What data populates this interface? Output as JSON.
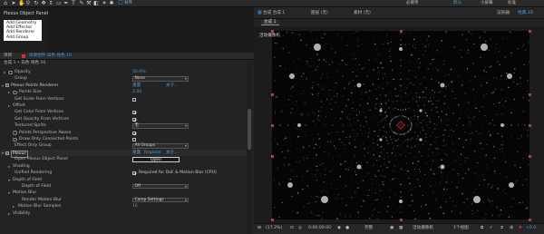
{
  "toolbar": {
    "snap_label": "对齐",
    "workspace_essentials": "必要项",
    "workspace_default": "默认",
    "workspace_small": "小屏幕",
    "workspace_standard": "标准",
    "icons": [
      "home-icon",
      "selection-icon",
      "hand-icon",
      "zoom-icon",
      "orbit-icon",
      "pan-icon",
      "dolly-icon",
      "rect-icon",
      "pen-icon",
      "text-icon",
      "brush-icon",
      "stamp-icon",
      "eraser-icon",
      "roto-icon",
      "puppet-icon",
      "snap-icon"
    ]
  },
  "plexus_panel": {
    "title": "Plexus Object Panel",
    "menu": [
      "Add Geometry",
      "Add Effector",
      "Add Renderer",
      "Add Group"
    ]
  },
  "left_panel": {
    "tabs": [
      "项目",
      "效果控件 白色 纯色 10"
    ],
    "breadcrumb": "合成 1 • 白色 纯色 10",
    "rows": [
      {
        "label": "Opacity",
        "value": "50.0%",
        "type": "value"
      },
      {
        "label": "Group",
        "value": "None",
        "type": "dropdown"
      },
      {
        "label": "Plexus Points Renderer",
        "value": "重置",
        "extra": "关于...",
        "type": "section"
      },
      {
        "label": "Points Size",
        "value": "2.00",
        "type": "value"
      },
      {
        "label": "Get Scale From Vertices",
        "value": "",
        "type": "check"
      },
      {
        "label": "Offset",
        "value": "",
        "type": "group"
      },
      {
        "label": "Get Color From Vertices",
        "value": "",
        "type": "checkon"
      },
      {
        "label": "Get Opacity From Vertices",
        "value": "",
        "type": "checkon"
      },
      {
        "label": "Textured Sprite",
        "value": "无",
        "type": "dropdown"
      },
      {
        "label": "Points Perspective Aware",
        "value": "",
        "type": "checkon"
      },
      {
        "label": "Draw Only Connected Points",
        "value": "",
        "type": "check"
      },
      {
        "label": "Effect Only Group",
        "value": "All Groups",
        "type": "dropdown"
      },
      {
        "label": "Plexus",
        "value": "重置",
        "extra": "Register",
        "extra2": "关于...",
        "type": "section"
      },
      {
        "label": "Open Plexus Object Panel",
        "value": "Open",
        "type": "button"
      },
      {
        "label": "Shading",
        "value": "",
        "type": "group"
      },
      {
        "label": "Unified Rendering",
        "value": "Required for DoF & Motion Blur (CPU)",
        "type": "checkon"
      },
      {
        "label": "Depth of Field",
        "value": "",
        "type": "group"
      },
      {
        "label": "Depth of Field",
        "value": "Off",
        "type": "dropdown"
      },
      {
        "label": "Motion Blur",
        "value": "",
        "type": "group"
      },
      {
        "label": "Render Motion Blur",
        "value": "Comp Settings",
        "type": "dropdown"
      },
      {
        "label": "Motion Blur Samples",
        "value": "16",
        "type": "value"
      },
      {
        "label": "Visibility",
        "value": "",
        "type": "group"
      }
    ]
  },
  "viewer": {
    "top_label_1": "合成 合成 1",
    "top_label_2": "图层 (无)",
    "top_label_3": "素材 (无)",
    "top_label_4": "渲染器:",
    "top_label_5": "经典 3D",
    "tab": "合成 1",
    "camera_label": "活动摄像机",
    "zoom": "(17.2%)",
    "timecode": "0:00:00:00",
    "resolution": "完整",
    "camera_select": "活动摄像机",
    "view_count": "1个视图",
    "exposure": "+0.0",
    "accent": "#cc3333"
  }
}
